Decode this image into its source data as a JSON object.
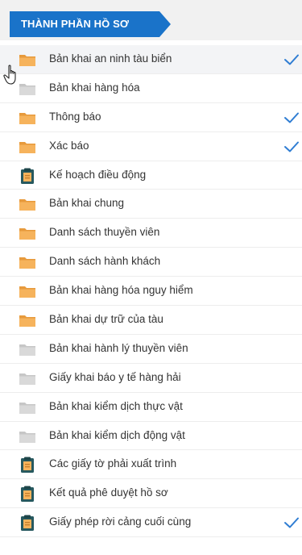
{
  "header": {
    "title": "THÀNH PHẦN HỒ SƠ",
    "accent_color": "#1a73c9"
  },
  "colors": {
    "folder_orange": "#f6b35c",
    "folder_grey": "#d9d9d9",
    "clipboard": "#27595f",
    "check": "#2f7dd3"
  },
  "items": [
    {
      "label": "Bản khai an ninh tàu biển",
      "icon": "folder-orange-icon",
      "checked": true
    },
    {
      "label": "Bản khai hàng hóa",
      "icon": "folder-grey-icon",
      "checked": false
    },
    {
      "label": "Thông báo",
      "icon": "folder-orange-icon",
      "checked": true
    },
    {
      "label": "Xác báo",
      "icon": "folder-orange-icon",
      "checked": true
    },
    {
      "label": "Kế hoạch điều động",
      "icon": "clipboard-icon",
      "checked": false
    },
    {
      "label": "Bản khai chung",
      "icon": "folder-orange-icon",
      "checked": false
    },
    {
      "label": "Danh sách thuyền viên",
      "icon": "folder-orange-icon",
      "checked": false
    },
    {
      "label": "Danh sách hành khách",
      "icon": "folder-orange-icon",
      "checked": false
    },
    {
      "label": "Bản khai hàng hóa nguy hiểm",
      "icon": "folder-orange-icon",
      "checked": false
    },
    {
      "label": "Bản khai dự trữ của tàu",
      "icon": "folder-orange-icon",
      "checked": false
    },
    {
      "label": "Bản khai hành lý thuyền viên",
      "icon": "folder-grey-icon",
      "checked": false
    },
    {
      "label": "Giấy khai báo y tế hàng hải",
      "icon": "folder-grey-icon",
      "checked": false
    },
    {
      "label": "Bản khai kiểm dịch thực vật",
      "icon": "folder-grey-icon",
      "checked": false
    },
    {
      "label": "Bản khai kiểm dịch động vật",
      "icon": "folder-grey-icon",
      "checked": false
    },
    {
      "label": "Các giấy tờ phải xuất trình",
      "icon": "clipboard-icon",
      "checked": false
    },
    {
      "label": "Kết quả phê duyệt hồ sơ",
      "icon": "clipboard-icon",
      "checked": false
    },
    {
      "label": "Giấy phép rời cảng cuối cùng",
      "icon": "clipboard-icon",
      "checked": true
    }
  ]
}
